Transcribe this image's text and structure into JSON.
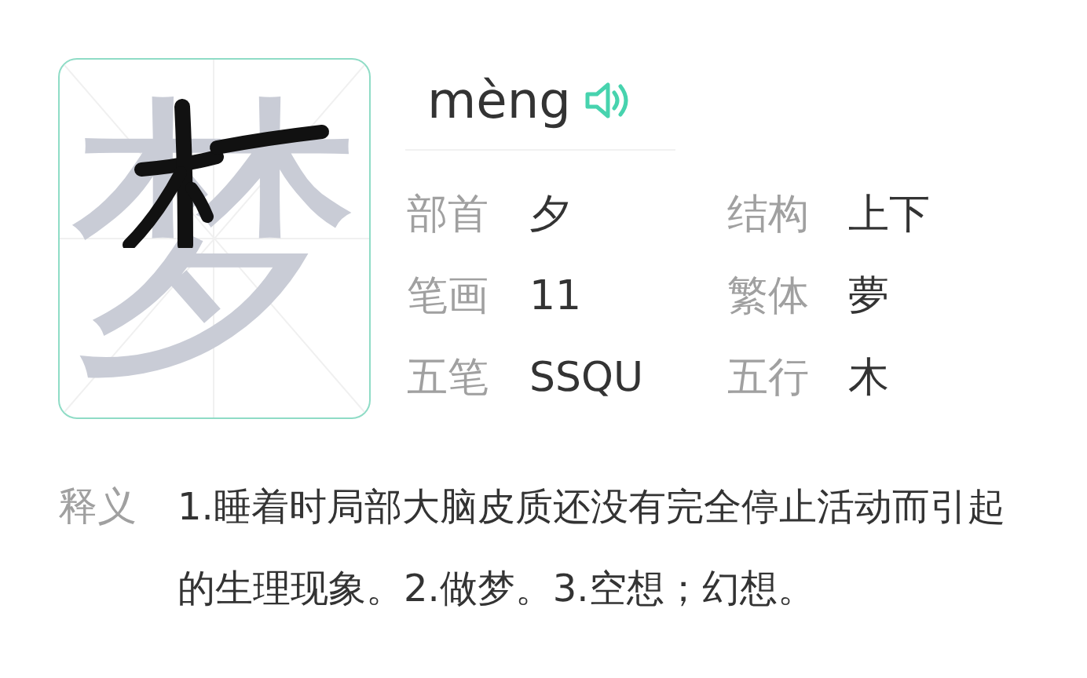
{
  "character": {
    "glyph": "梦"
  },
  "pinyin": "mèng",
  "attributes": [
    {
      "label": "部首",
      "value": "夕"
    },
    {
      "label": "结构",
      "value": "上下"
    },
    {
      "label": "笔画",
      "value": "11"
    },
    {
      "label": "繁体",
      "value": "夢"
    },
    {
      "label": "五笔",
      "value": "SSQU"
    },
    {
      "label": "五行",
      "value": "木"
    }
  ],
  "definition": {
    "label": "释义",
    "text": "1.睡着时局部大脑皮质还没有完全停止活动而引起的生理现象。2.做梦。3.空想；幻想。"
  }
}
